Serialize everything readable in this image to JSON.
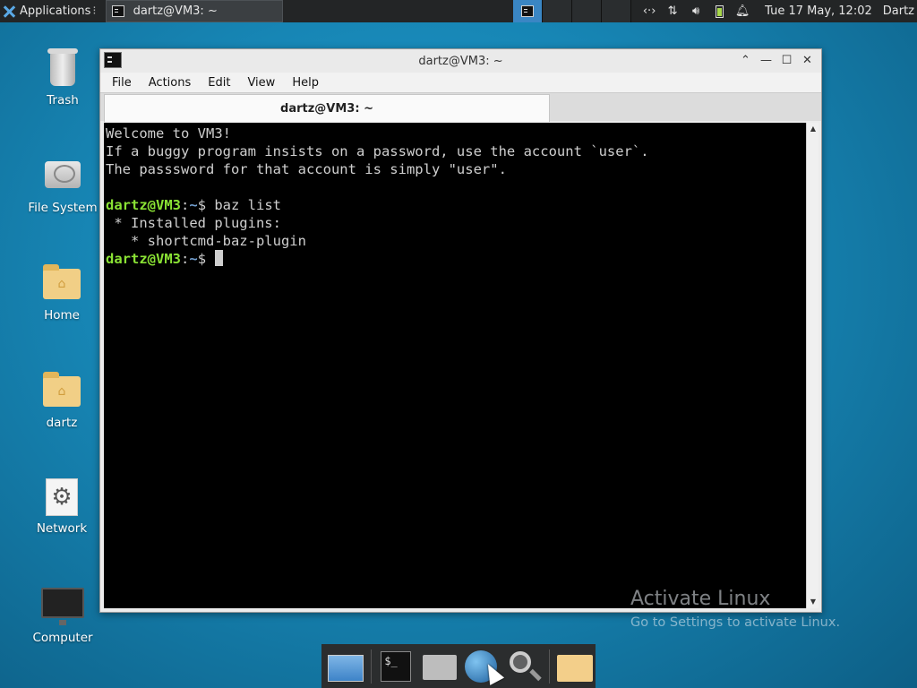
{
  "top_panel": {
    "applications_label": "Applications",
    "task_label": "dartz@VM3: ~",
    "clock": "Tue 17 May, 12:02",
    "user": "Dartz",
    "tray_icons": [
      "network-arrows-icon",
      "network-transfer-icon",
      "volume-icon",
      "battery-icon",
      "notification-bell-icon"
    ]
  },
  "desktop": {
    "icons": [
      {
        "label": "Trash",
        "icon": "trash-icon"
      },
      {
        "label": "File System",
        "icon": "hard-drive-icon"
      },
      {
        "label": "Home",
        "icon": "home-folder-icon"
      },
      {
        "label": "dartz",
        "icon": "home-folder-icon"
      },
      {
        "label": "Network",
        "icon": "network-gear-icon"
      },
      {
        "label": "Computer",
        "icon": "monitor-icon"
      }
    ]
  },
  "terminal": {
    "title": "dartz@VM3: ~",
    "menu": [
      "File",
      "Actions",
      "Edit",
      "View",
      "Help"
    ],
    "tab_title": "dartz@VM3: ~",
    "lines": {
      "l1": "Welcome to VM3!",
      "l2": "If a buggy program insists on a password, use the account `user`.",
      "l3": "The passsword for that account is simply \"user\".",
      "l5_user": "dartz@VM3",
      "l5_colon": ":",
      "l5_path": "~",
      "l5_cmd": "$ baz list",
      "l6": " * Installed plugins:",
      "l7": "   * shortcmd-baz-plugin",
      "l8_user": "dartz@VM3",
      "l8_colon": ":",
      "l8_path": "~",
      "l8_cmd": "$ "
    }
  },
  "watermark": {
    "title": "Activate Linux",
    "subtitle": "Go to Settings to activate Linux."
  },
  "dock": {
    "items": [
      "show-desktop-icon",
      "terminal-icon",
      "home-folder-icon",
      "web-browser-icon",
      "search-icon",
      "files-folder-icon"
    ]
  }
}
